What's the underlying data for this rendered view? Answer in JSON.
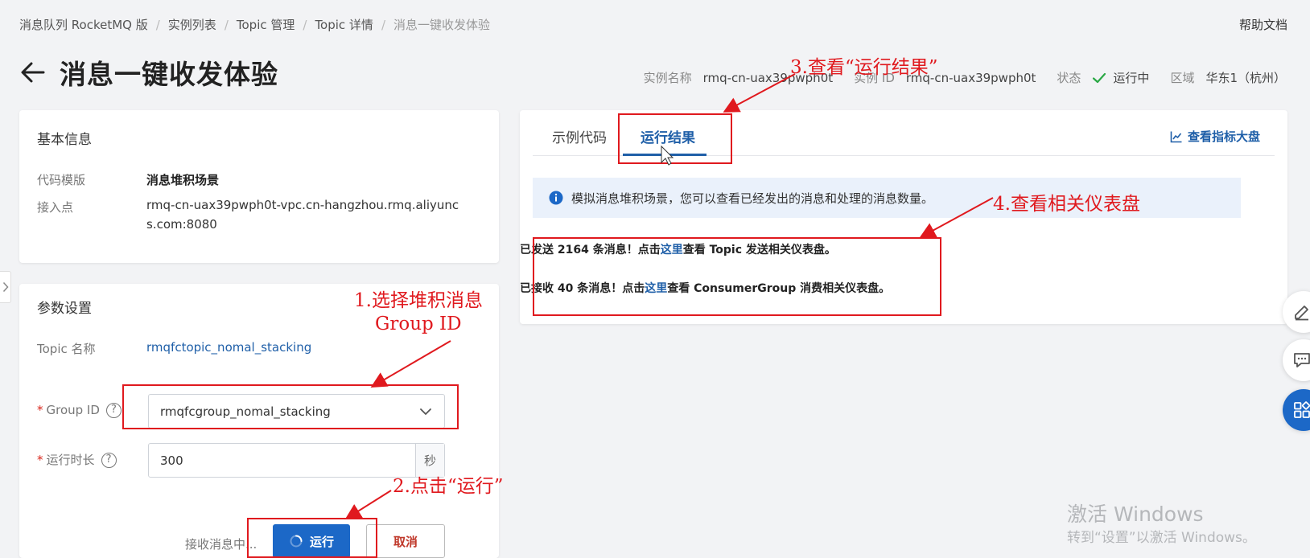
{
  "breadcrumb": {
    "items": [
      "消息队列 RocketMQ 版",
      "实例列表",
      "Topic 管理",
      "Topic 详情",
      "消息一键收发体验"
    ],
    "separator": "/"
  },
  "header": {
    "help_label": "帮助文档",
    "title": "消息一键收发体验",
    "instance_name_label": "实例名称",
    "instance_name": "rmq-cn-uax39pwph0t",
    "instance_id_label": "实例 ID",
    "instance_id": "rmq-cn-uax39pwph0t",
    "status_label": "状态",
    "status": "运行中",
    "region_label": "区域",
    "region": "华东1（杭州）"
  },
  "basic_info": {
    "title": "基本信息",
    "template_label": "代码模版",
    "template_value": "消息堆积场景",
    "endpoint_label": "接入点",
    "endpoint_value": "rmq-cn-uax39pwph0t-vpc.cn-hangzhou.rmq.aliyuncs.com:8080"
  },
  "params": {
    "title": "参数设置",
    "topic_label": "Topic 名称",
    "topic_value": "rmqfctopic_nomal_stacking",
    "required_mark": "*",
    "group_label": "Group ID",
    "group_value": "rmqfcgroup_nomal_stacking",
    "duration_label": "运行时长",
    "duration_value": "300",
    "duration_unit": "秒",
    "help_mark": "?",
    "receiving_text": "接收消息中...",
    "run_label": "运行",
    "cancel_label": "取消"
  },
  "result": {
    "tabs": [
      {
        "label": "示例代码",
        "active": false
      },
      {
        "label": "运行结果",
        "active": true
      }
    ],
    "dashboard_link": "查看指标大盘",
    "info_text": "模拟消息堆积场景，您可以查看已经发出的消息和处理的消息数量。",
    "sent": {
      "prefix": "已发送 2164 条消息！点击",
      "link": "这里",
      "suffix": "查看 Topic 发送相关仪表盘。"
    },
    "received": {
      "prefix": "已接收 40 条消息！点击",
      "link": "这里",
      "suffix": "查看 ConsumerGroup 消费相关仪表盘。"
    }
  },
  "annotations": {
    "step1_line1": "1.选择堆积消息",
    "step1_line2": "Group ID",
    "step2": "2.点击“运行”",
    "step3": "3.查看“运行结果”",
    "step4": "4.查看相关仪表盘"
  },
  "watermark": {
    "title": "激活 Windows",
    "subtitle": "转到“设置”以激活 Windows。"
  },
  "icons": {
    "back": "back-arrow-icon",
    "status": "check-icon",
    "select": "chevron-down-icon",
    "help": "question-circle-icon",
    "run": "loading-spinner-icon",
    "dashboard": "line-chart-icon",
    "info": "info-circle-icon",
    "float_1": "edit-icon",
    "float_2": "chat-icon",
    "float_3": "apps-grid-icon"
  },
  "colors": {
    "primary": "#1c68c7",
    "link": "#1f5fa8",
    "annotation": "#e0191e",
    "success": "#2aa845",
    "info_bg": "#eaf1fb"
  }
}
